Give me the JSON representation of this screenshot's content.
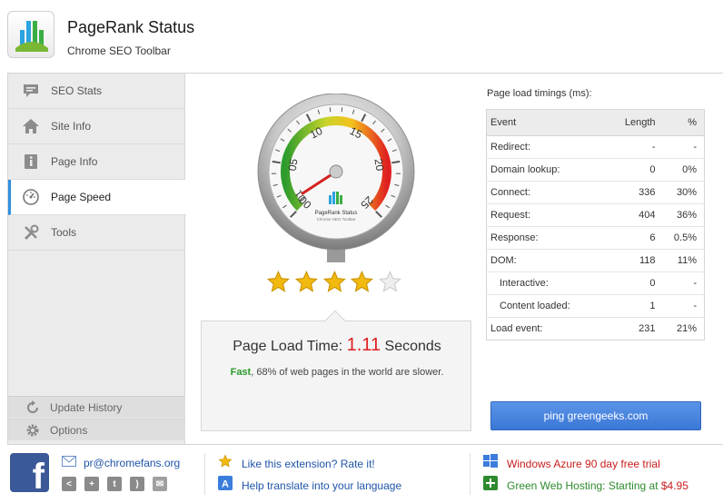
{
  "app": {
    "title": "PageRank Status",
    "subtitle": "Chrome SEO Toolbar",
    "gauge_brand": "PageRank Status",
    "gauge_sub": "Chrome SEO Toolbar"
  },
  "sidebar": {
    "items": [
      {
        "label": "SEO Stats",
        "icon": "chat-bubble-icon"
      },
      {
        "label": "Site Info",
        "icon": "house-icon"
      },
      {
        "label": "Page Info",
        "icon": "info-icon"
      },
      {
        "label": "Page Speed",
        "icon": "speedometer-icon",
        "active": true
      },
      {
        "label": "Tools",
        "icon": "tools-icon"
      }
    ],
    "bottom": [
      {
        "label": "Update History",
        "icon": "refresh-icon"
      },
      {
        "label": "Options",
        "icon": "gear-icon"
      }
    ]
  },
  "gauge": {
    "ticks": [
      "00",
      "05",
      "10",
      "15",
      "20",
      "25"
    ],
    "minor_tick": "01",
    "value": 1.11,
    "max": 25
  },
  "rating": {
    "value": 4,
    "max": 5
  },
  "result": {
    "prefix": "Page Load Time: ",
    "value": "1.11",
    "suffix": " Seconds",
    "fast_label": "Fast",
    "desc": ", 68% of web pages in the world are slower."
  },
  "timings": {
    "title": "Page load timings (ms):",
    "headers": [
      "Event",
      "Length",
      "%"
    ],
    "rows": [
      {
        "event": "Redirect:",
        "length": "-",
        "pct": "-",
        "indent": false
      },
      {
        "event": "Domain lookup:",
        "length": "0",
        "pct": "0%",
        "indent": false
      },
      {
        "event": "Connect:",
        "length": "336",
        "pct": "30%",
        "indent": false
      },
      {
        "event": "Request:",
        "length": "404",
        "pct": "36%",
        "indent": false
      },
      {
        "event": "Response:",
        "length": "6",
        "pct": "0.5%",
        "indent": false
      },
      {
        "event": "DOM:",
        "length": "118",
        "pct": "11%",
        "indent": false
      },
      {
        "event": "Interactive:",
        "length": "0",
        "pct": "-",
        "indent": true
      },
      {
        "event": "Content loaded:",
        "length": "1",
        "pct": "-",
        "indent": true
      },
      {
        "event": "Load event:",
        "length": "231",
        "pct": "21%",
        "indent": false
      }
    ]
  },
  "ping": {
    "label": "ping greengeeks.com"
  },
  "footer": {
    "email": "pr@chromefans.org",
    "rate": "Like this extension? Rate it!",
    "translate": "Help translate into your language",
    "azure": "Windows Azure 90 day free trial",
    "hosting_text": "Green Web Hosting: Starting at ",
    "hosting_price": "$4.95",
    "share_icons": [
      "share-icon",
      "google-plus-icon",
      "tumblr-icon",
      "rss-icon",
      "mail-icon"
    ]
  },
  "colors": {
    "accent": "#2f8fe0",
    "result_value": "#e02020",
    "fast": "#2a9a2a",
    "button": "#3a77d6",
    "facebook": "#3b5998",
    "star": "#f2b90f"
  }
}
